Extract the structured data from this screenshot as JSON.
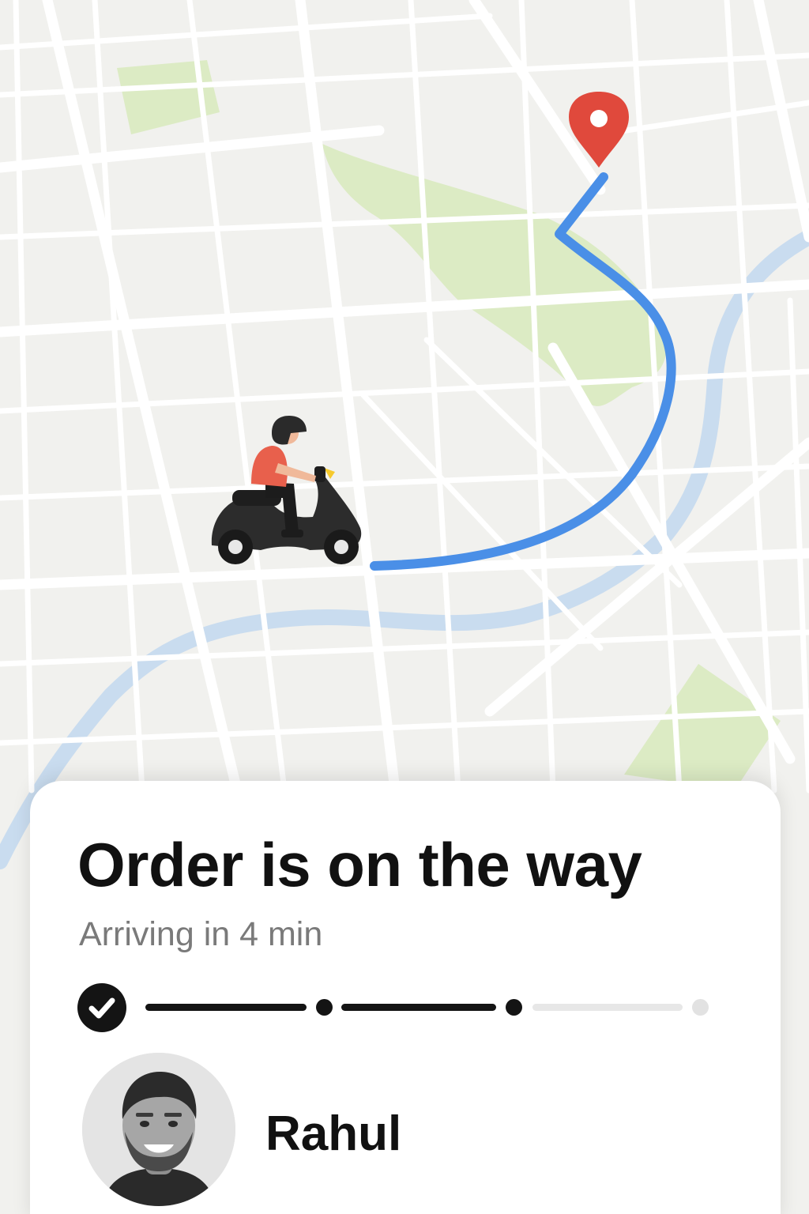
{
  "map": {
    "route_color": "#4a8fe7",
    "destination_pin_color": "#e0493c",
    "park_color": "#dcebc4",
    "water_color": "#c9dcef",
    "road_color": "#ffffff",
    "background_color": "#f1f1ee",
    "courier_icon": "scooter-rider-icon",
    "destination_icon": "location-pin-icon"
  },
  "order": {
    "title": "Order is on the way",
    "subtitle": "Arriving in 4 min"
  },
  "progress": {
    "total_steps": 4,
    "completed_steps": 3,
    "first_step_icon": "check-icon",
    "active_color": "#141414",
    "inactive_color": "#e5e5e5"
  },
  "courier": {
    "name": "Rahul",
    "avatar_icon": "driver-avatar"
  }
}
